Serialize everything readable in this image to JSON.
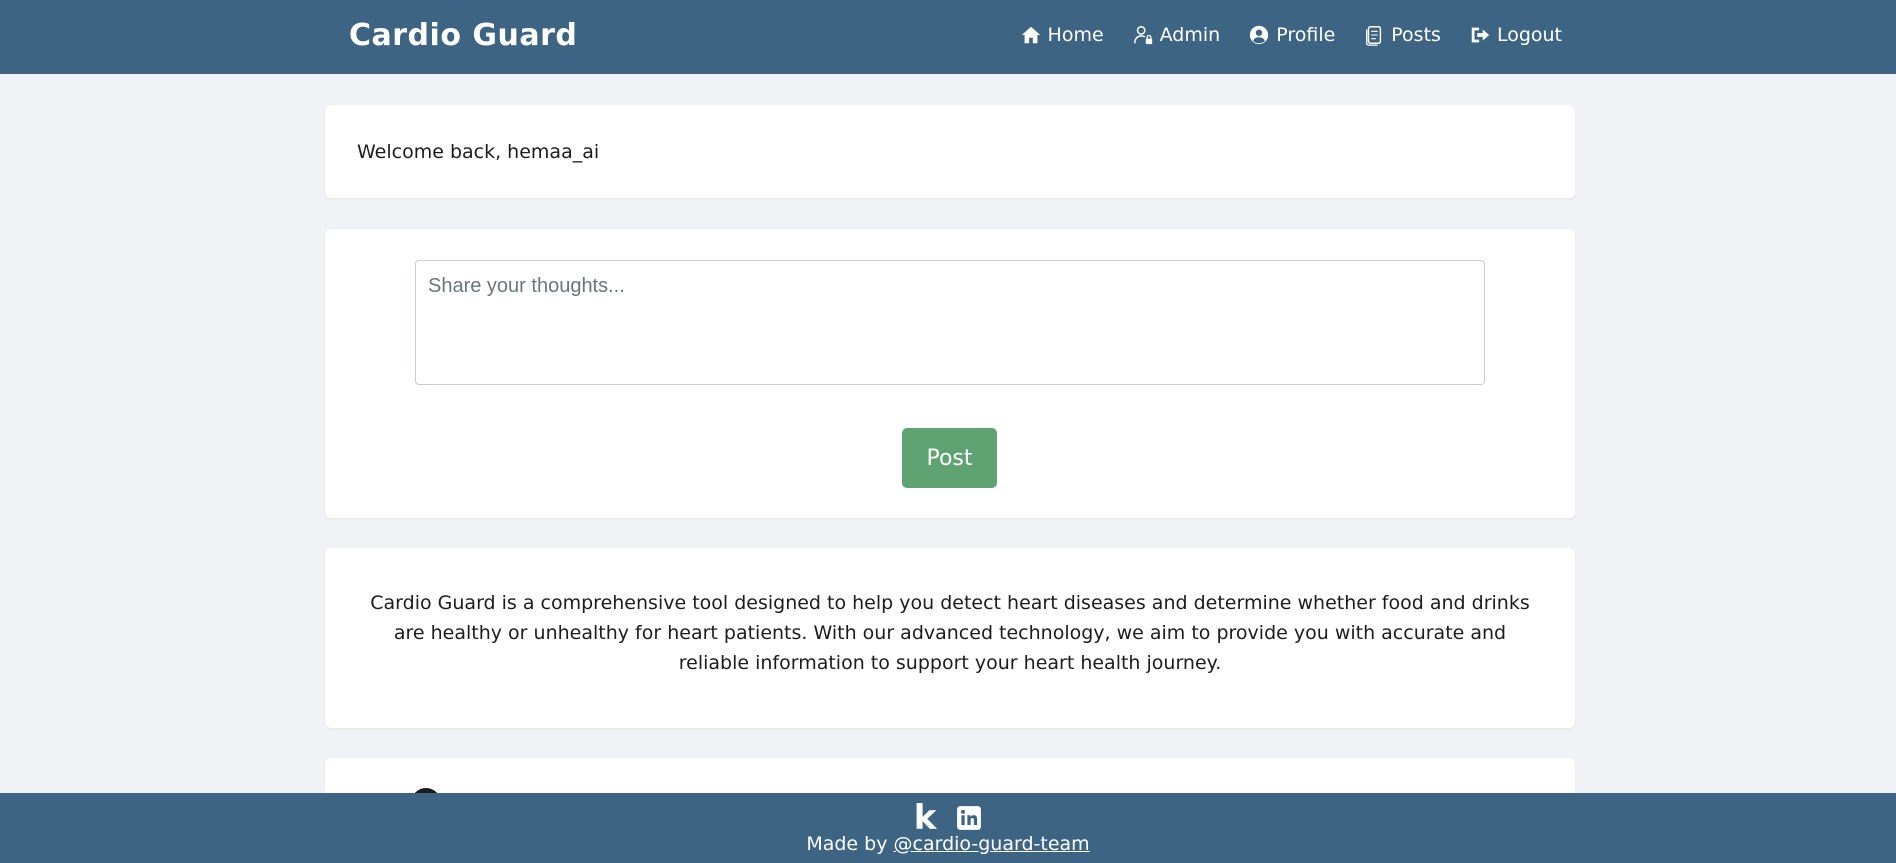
{
  "navbar": {
    "brand": "Cardio Guard",
    "links": [
      {
        "label": "Home",
        "icon": "home-icon"
      },
      {
        "label": "Admin",
        "icon": "admin-user-lock-icon"
      },
      {
        "label": "Profile",
        "icon": "user-circle-icon"
      },
      {
        "label": "Posts",
        "icon": "clipboard-icon"
      },
      {
        "label": "Logout",
        "icon": "sign-out-icon"
      }
    ]
  },
  "welcome": {
    "text": "Welcome back, hemaa_ai"
  },
  "post_form": {
    "placeholder": "Share your thoughts...",
    "value": "",
    "button_label": "Post"
  },
  "about": {
    "text": "Cardio Guard is a comprehensive tool designed to help you detect heart diseases and determine whether food and drinks are healthy or unhealthy for heart patients. With our advanced technology, we aim to provide you with accurate and reliable information to support your heart health journey."
  },
  "footer": {
    "social": [
      {
        "label": "k",
        "icon": "kaggle-icon"
      },
      {
        "label": "",
        "icon": "linkedin-icon"
      }
    ],
    "credit_prefix": "Made by ",
    "credit_link": "@cardio-guard-team"
  },
  "colors": {
    "primary": "#3d6483",
    "background": "#f1f2f5",
    "button": "#5fa372",
    "card": "#ffffff"
  }
}
